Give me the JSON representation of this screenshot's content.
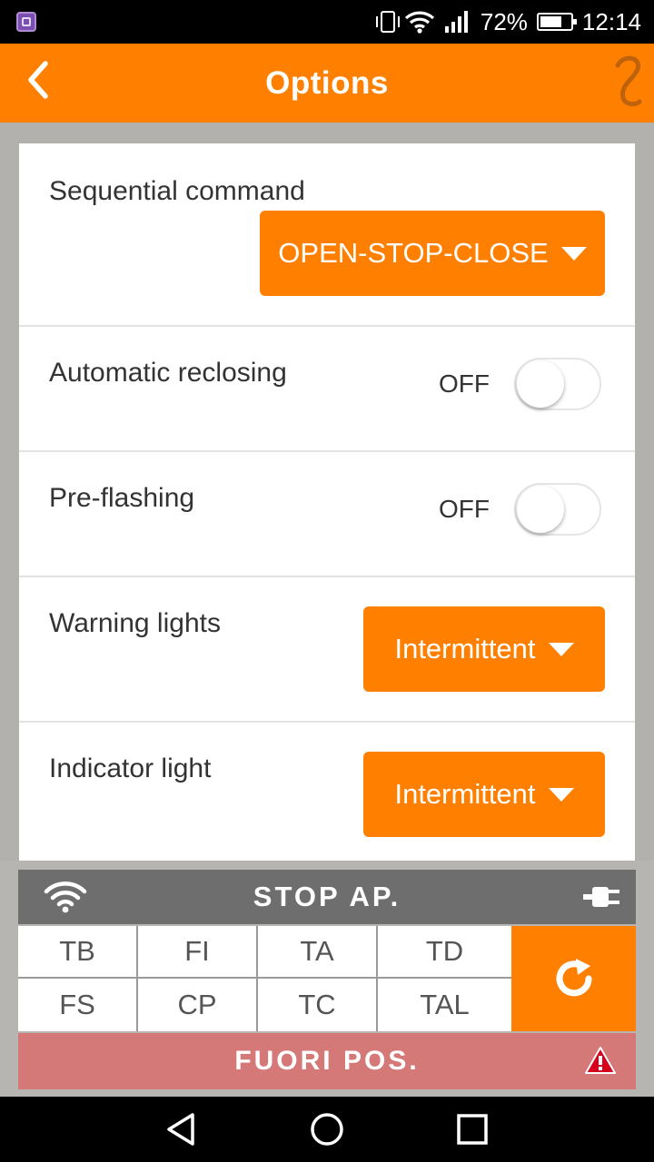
{
  "status_bar": {
    "battery": "72%",
    "battery_level": 0.72,
    "time": "12:14",
    "icons": [
      "app-notification-icon",
      "vibrate-icon",
      "wifi-icon",
      "signal-icon",
      "battery-icon"
    ]
  },
  "header": {
    "title": "Options",
    "back_icon": "chevron-left-icon",
    "logo_icon": "brand-logo-icon",
    "color": "#ff7f00"
  },
  "options": {
    "sequential_command": {
      "label": "Sequential command",
      "value": "OPEN-STOP-CLOSE"
    },
    "automatic_reclosing": {
      "label": "Automatic reclosing",
      "state": "OFF"
    },
    "pre_flashing": {
      "label": "Pre-flashing",
      "state": "OFF"
    },
    "warning_lights": {
      "label": "Warning lights",
      "value": "Intermittent"
    },
    "indicator_light": {
      "label": "Indicator light",
      "value": "Intermittent"
    }
  },
  "status_panel": {
    "status": "STOP AP.",
    "grid": [
      [
        "TB",
        "FI",
        "TA",
        "TD"
      ],
      [
        "FS",
        "CP",
        "TC",
        "TAL"
      ]
    ],
    "alarm": "FUORI POS.",
    "alarm_color": "#d47878",
    "icons": [
      "wifi-icon",
      "plug-icon",
      "refresh-icon",
      "warning-icon"
    ]
  },
  "nav_bar": {
    "icons": [
      "back-triangle-icon",
      "home-circle-icon",
      "recents-square-icon"
    ]
  }
}
